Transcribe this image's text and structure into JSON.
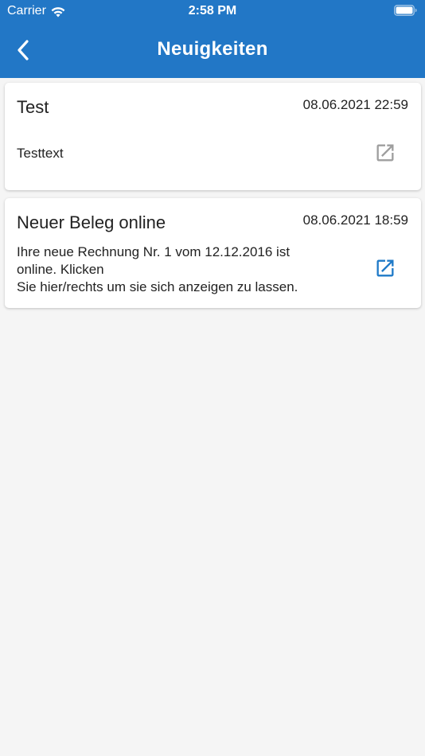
{
  "status_bar": {
    "carrier": "Carrier",
    "time": "2:58 PM"
  },
  "nav": {
    "title": "Neuigkeiten",
    "back_icon": "chevron-left-icon"
  },
  "colors": {
    "header_bg": "#2277c6",
    "link_active": "#1f7ac8",
    "link_inactive": "#9e9e9e"
  },
  "news": [
    {
      "title": "Test",
      "date": "08.06.2021 22:59",
      "text_lines": [
        "Testtext"
      ],
      "open_icon": "open-in-new-icon",
      "link_active": false
    },
    {
      "title": "Neuer Beleg online",
      "date": "08.06.2021 18:59",
      "text_lines": [
        "Ihre neue Rechnung Nr. 1 vom 12.12.2016 ist",
        "online. Klicken",
        "Sie hier/rechts um sie sich anzeigen zu lassen."
      ],
      "open_icon": "open-in-new-icon",
      "link_active": true
    }
  ]
}
